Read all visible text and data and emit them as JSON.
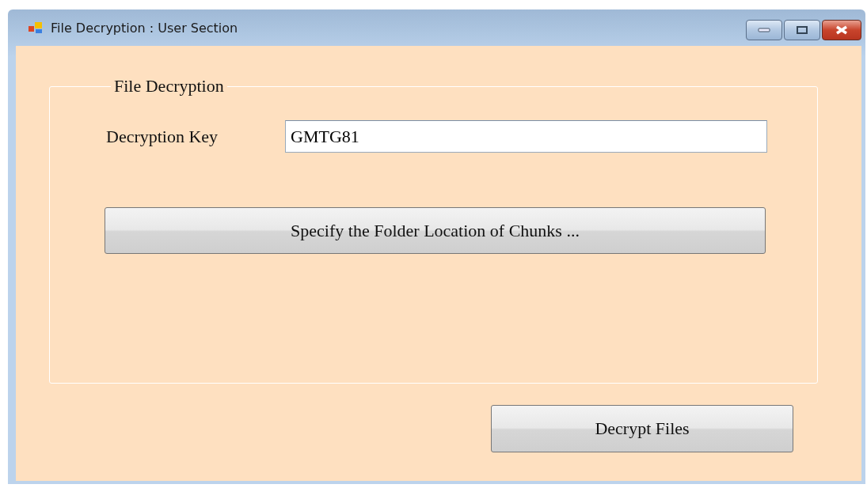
{
  "window": {
    "title": "File Decryption : User Section"
  },
  "group": {
    "title": "File Decryption",
    "key_label": "Decryption Key",
    "key_value": "GMTG81",
    "folder_button": "Specify the Folder Location of Chunks ..."
  },
  "buttons": [
    "Decrypt Files"
  ]
}
